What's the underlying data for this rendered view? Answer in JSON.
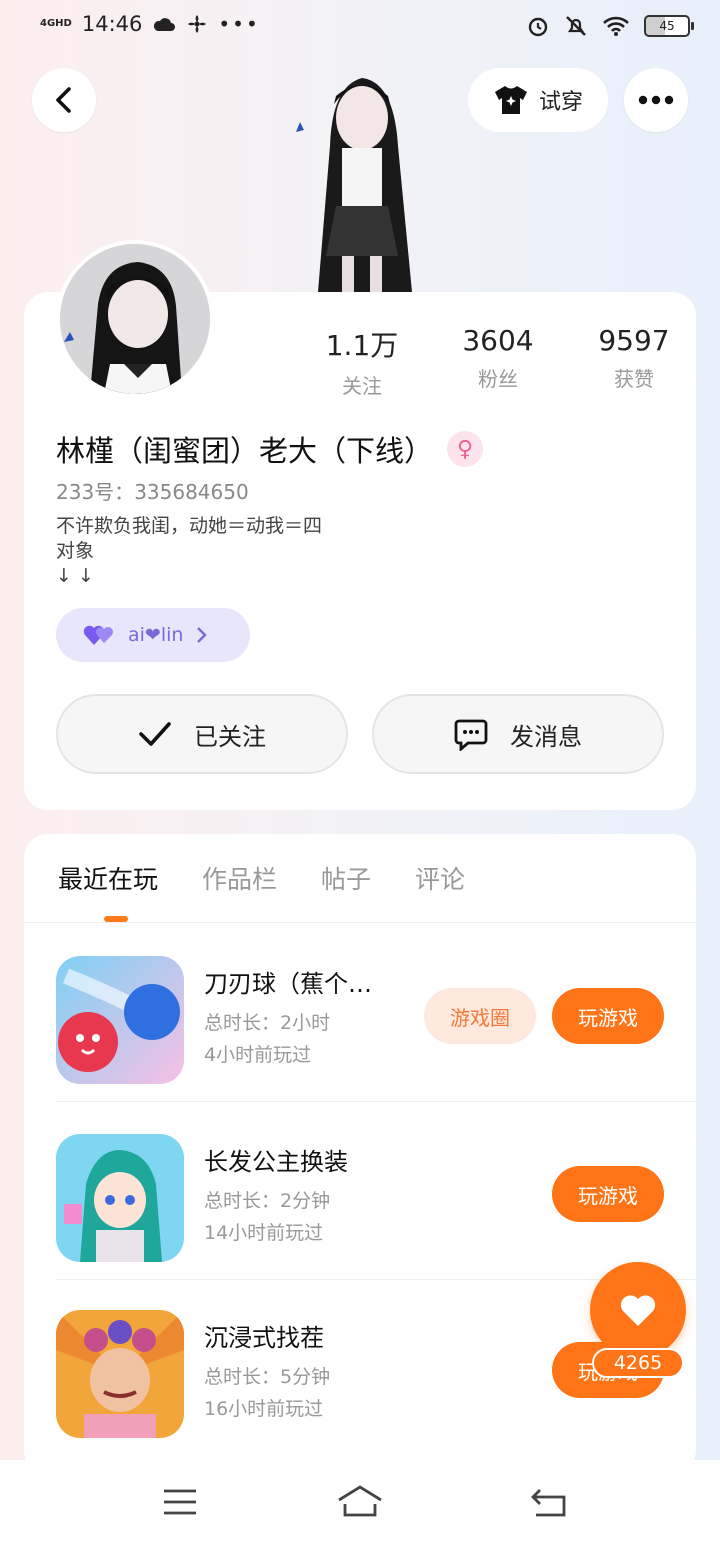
{
  "status_bar": {
    "network": "4GHD",
    "time": "14:46",
    "battery": "45"
  },
  "top_bar": {
    "try_on_label": "试穿"
  },
  "profile": {
    "stats": [
      {
        "value": "1.1万",
        "label": "关注"
      },
      {
        "value": "3604",
        "label": "粉丝"
      },
      {
        "value": "9597",
        "label": "获赞"
      }
    ],
    "name": "林槿（闺蜜团）老大（下线）",
    "uid_label": "233号：",
    "uid": "335684650",
    "bio_line1": "不许欺负我闺，动她＝动我＝四",
    "bio_line2": "对象",
    "bio_line3": "↓ ↓",
    "tag_text": "ai❤lin",
    "follow_label": "已关注",
    "message_label": "发消息"
  },
  "tabs": [
    "最近在玩",
    "作品栏",
    "帖子",
    "评论"
  ],
  "games": [
    {
      "title": "刀刃球（蕉个…",
      "duration": "总时长：2小时",
      "last_played": "4小时前玩过",
      "circle_label": "游戏圈",
      "play_label": "玩游戏"
    },
    {
      "title": "长发公主换装",
      "duration": "总时长：2分钟",
      "last_played": "14小时前玩过",
      "play_label": "玩游戏"
    },
    {
      "title": "沉浸式找茬",
      "duration": "总时长：5分钟",
      "last_played": "16小时前玩过",
      "play_label": "玩游戏"
    }
  ],
  "fab": {
    "count": "4265"
  },
  "colors": {
    "accent": "#ff7416",
    "accent_light": "#ffe9df",
    "tag_bg": "#e8e6fb",
    "gender": "#f06292"
  }
}
